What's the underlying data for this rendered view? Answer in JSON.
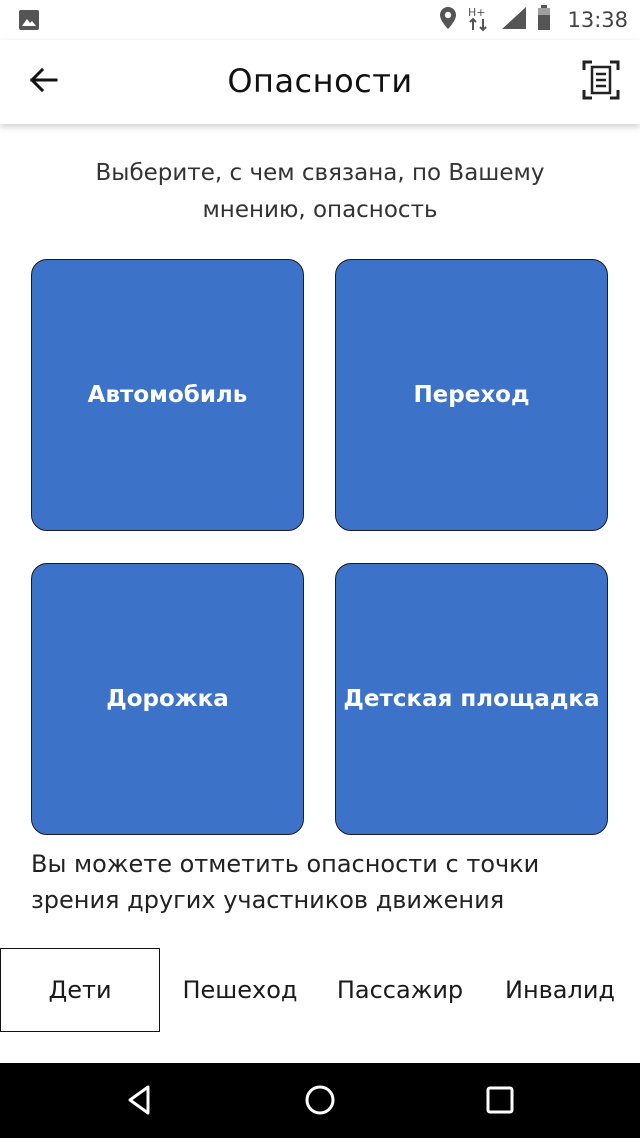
{
  "status_bar": {
    "time": "13:38",
    "network_type": "H+",
    "icons": [
      "gallery-icon",
      "location-icon",
      "network-icon",
      "signal-icon",
      "battery-icon"
    ]
  },
  "app_bar": {
    "title": "Опасности",
    "back_icon": "arrow-left-icon",
    "action_icon": "scan-document-icon"
  },
  "main": {
    "prompt": "Выберите, с чем связана, по Вашему мнению, опасность",
    "categories": [
      {
        "label": "Автомобиль"
      },
      {
        "label": "Переход"
      },
      {
        "label": "Дорожка"
      },
      {
        "label": "Детская площадка"
      }
    ],
    "note": "Вы можете отметить опасности с точки зрения других участников движения"
  },
  "tabs": [
    {
      "label": "Дети",
      "selected": true
    },
    {
      "label": "Пешеход",
      "selected": false
    },
    {
      "label": "Пассажир",
      "selected": false
    },
    {
      "label": "Инвалид",
      "selected": false
    }
  ],
  "nav_bar": {
    "icons": [
      "back-triangle-icon",
      "home-circle-icon",
      "recents-square-icon"
    ]
  },
  "colors": {
    "tile_fill": "#3d72c9",
    "tile_border": "#1b1b1b",
    "nav_bar": "#000000",
    "text": "#222222"
  }
}
